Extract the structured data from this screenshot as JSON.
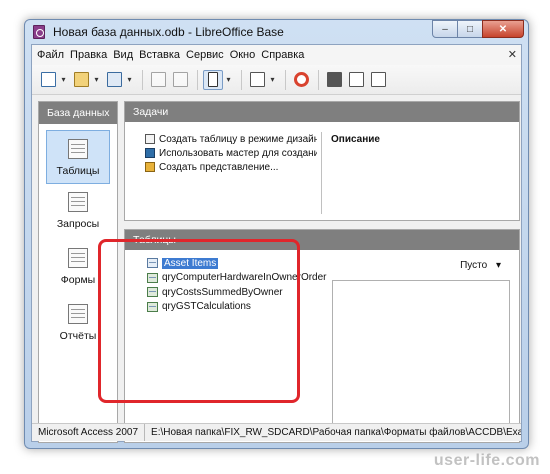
{
  "window": {
    "title": "Новая база данных.odb - LibreOffice Base",
    "close_glyph": "✕",
    "min_glyph": "–",
    "max_glyph": "□"
  },
  "menu": {
    "items": [
      "Файл",
      "Правка",
      "Вид",
      "Вставка",
      "Сервис",
      "Окно",
      "Справка"
    ],
    "close_glyph": "✕"
  },
  "toolbar": {
    "icons": [
      "new-document-icon",
      "open-icon",
      "save-icon",
      "copy-icon",
      "paste-icon",
      "selection-icon",
      "form-icon",
      "help-icon",
      "table-design-icon",
      "edit-icon",
      "report-icon"
    ]
  },
  "sidebar": {
    "header": "База данных",
    "items": [
      {
        "label": "Таблицы",
        "icon": "tables-icon",
        "selected": true
      },
      {
        "label": "Запросы",
        "icon": "queries-icon",
        "selected": false
      },
      {
        "label": "Формы",
        "icon": "forms-icon",
        "selected": false
      },
      {
        "label": "Отчёты",
        "icon": "reports-icon",
        "selected": false
      }
    ]
  },
  "tasks": {
    "header": "Задачи",
    "items": [
      "Создать таблицу в режиме дизайна...",
      "Использовать мастер для создания та",
      "Создать представление..."
    ],
    "description_title": "Описание"
  },
  "tables": {
    "header": "Таблицы",
    "items": [
      {
        "name": "Asset Items",
        "selected": true
      },
      {
        "name": "qryComputerHardwareInOwnerOrder",
        "selected": false
      },
      {
        "name": "qryCostsSummedByOwner",
        "selected": false
      },
      {
        "name": "qryGSTCalculations",
        "selected": false
      }
    ],
    "preview_option": "Пусто",
    "preview_arrow": "▾"
  },
  "status": {
    "db_type": "Microsoft Access 2007",
    "path": "E:\\Новая папка\\FIX_RW_SDCARD\\Рабочая папка\\Форматы файлов\\ACCDB\\Example\\ASampleDat"
  },
  "watermark": "user-life.com",
  "colors": {
    "highlight": "#e0262b",
    "selection": "#3d7bd1",
    "panel_header": "#7f7f7f"
  }
}
